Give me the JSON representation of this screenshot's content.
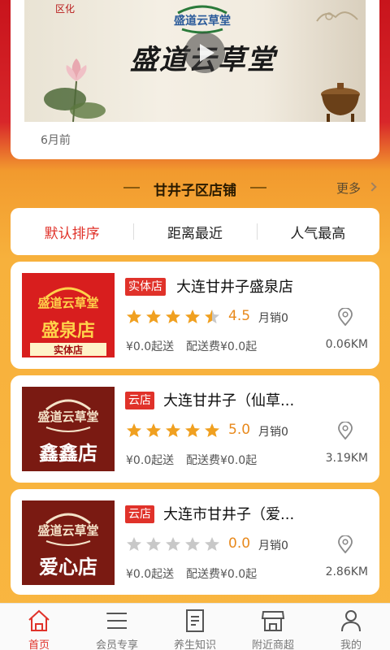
{
  "video": {
    "thumb_title": "盛道云草堂",
    "thumb_logo_text": "盛道云草堂",
    "time_ago": "6月前"
  },
  "section": {
    "title": "甘井子区店铺",
    "more_label": "更多"
  },
  "sort": {
    "options": [
      "默认排序",
      "距离最近",
      "人气最高"
    ],
    "active_index": 0
  },
  "stores": [
    {
      "badge": "实体店",
      "name": "大连甘井子盛泉店",
      "image_text": "盛泉店",
      "image_subtext": "实体店",
      "rating": "4.5",
      "rating_value": 4.5,
      "sales": "月销0",
      "min_order": "¥0.0起送",
      "delivery_fee": "配送费¥0.0起",
      "distance": "0.06KM"
    },
    {
      "badge": "云店",
      "name": "大连甘井子（仙草...",
      "image_text": "鑫鑫店",
      "rating": "5.0",
      "rating_value": 5.0,
      "sales": "月销0",
      "min_order": "¥0.0起送",
      "delivery_fee": "配送费¥0.0起",
      "distance": "3.19KM"
    },
    {
      "badge": "云店",
      "name": "大连市甘井子（爱...",
      "image_text": "爱心店",
      "rating": "0.0",
      "rating_value": 0.0,
      "sales": "月销0",
      "min_order": "¥0.0起送",
      "delivery_fee": "配送费¥0.0起",
      "distance": "2.86KM"
    }
  ],
  "tabbar": {
    "items": [
      {
        "label": "首页",
        "icon": "home-icon",
        "active": true
      },
      {
        "label": "会员专享",
        "icon": "list-icon",
        "active": false
      },
      {
        "label": "养生知识",
        "icon": "document-icon",
        "active": false
      },
      {
        "label": "附近商超",
        "icon": "store-icon",
        "active": false
      },
      {
        "label": "我的",
        "icon": "user-icon",
        "active": false
      }
    ]
  },
  "colors": {
    "accent": "#e0322a",
    "star_active": "#f0a020",
    "star_inactive": "#c8c8c8",
    "rating": "#e8891c",
    "store_img_bg_1": "#d81e1e",
    "store_img_bg_2": "#7a1a12"
  }
}
